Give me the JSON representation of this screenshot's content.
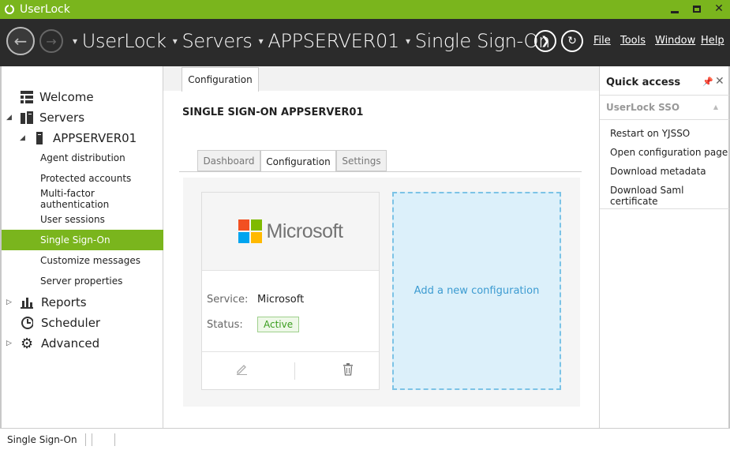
{
  "window": {
    "title": "UserLock"
  },
  "navbar": {
    "breadcrumb": [
      "UserLock",
      "Servers",
      "APPSERVER01",
      "Single Sign-On"
    ],
    "menu": [
      "File",
      "Tools",
      "Window",
      "Help"
    ]
  },
  "sidebar": {
    "items": [
      {
        "label": "Welcome",
        "icon": "grid-icon"
      },
      {
        "label": "Servers",
        "icon": "servers-icon"
      },
      {
        "label": "APPSERVER01",
        "icon": "server-icon"
      },
      {
        "label": "Agent distribution"
      },
      {
        "label": "Protected accounts"
      },
      {
        "label": "Multi-factor authentication"
      },
      {
        "label": "User sessions"
      },
      {
        "label": "Single Sign-On",
        "selected": true
      },
      {
        "label": "Customize messages"
      },
      {
        "label": "Server properties"
      },
      {
        "label": "Reports",
        "icon": "bar-chart-icon"
      },
      {
        "label": "Scheduler",
        "icon": "clock-icon"
      },
      {
        "label": "Advanced",
        "icon": "gear-icon"
      }
    ]
  },
  "main": {
    "doc_tab": "Configuration",
    "title": "SINGLE SIGN-ON APPSERVER01",
    "tabs": [
      "Dashboard",
      "Configuration",
      "Settings"
    ],
    "active_tab": "Configuration",
    "card": {
      "brand": "Microsoft",
      "service_label": "Service:",
      "service_value": "Microsoft",
      "status_label": "Status:",
      "status_value": "Active"
    },
    "add_config": "Add a new configuration"
  },
  "quick_access": {
    "title": "Quick access",
    "section": "UserLock SSO",
    "links": [
      "Restart on YJSSO",
      "Open configuration page",
      "Download metadata",
      "Download Saml certificate"
    ]
  },
  "statusbar": {
    "text": "Single Sign-On"
  },
  "colors": {
    "accent": "#7ab51d",
    "navbar": "#2b2b2b",
    "link": "#3c9bd1",
    "active_badge": "#3a9d1e"
  }
}
